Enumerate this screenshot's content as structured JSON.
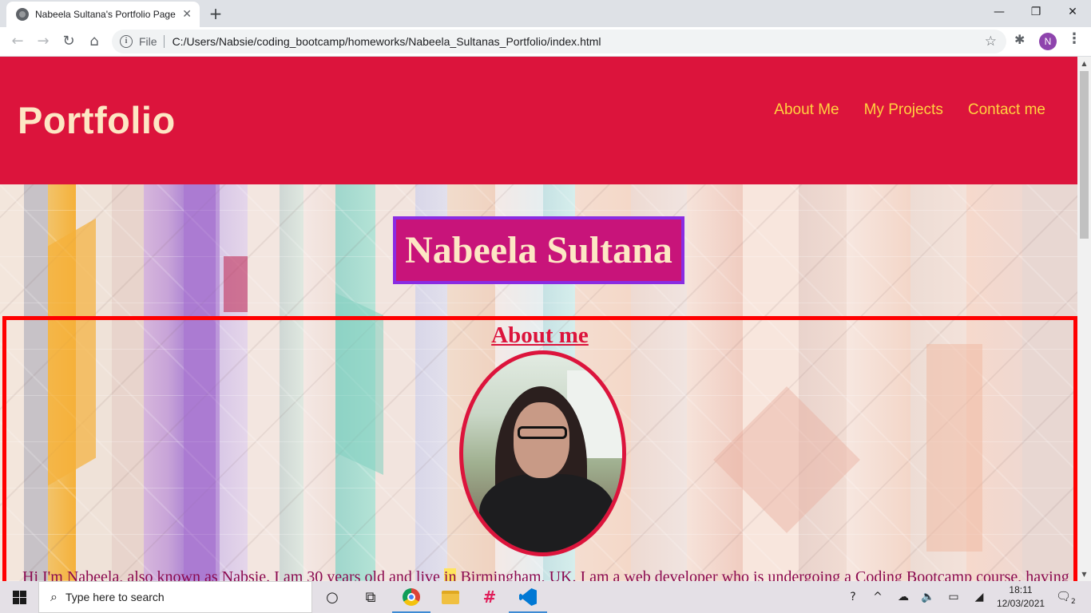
{
  "browser": {
    "tab_title": "Nabeela Sultana's Portfolio Page",
    "tab_close": "✕",
    "new_tab": "+",
    "win_minimize": "—",
    "win_restore": "❐",
    "win_close": "✕",
    "back": "←",
    "forward": "→",
    "reload": "↻",
    "home": "⌂",
    "site_info": "i",
    "file_label": "File",
    "url": "C:/Users/Nabsie/coding_bootcamp/homeworks/Nabeela_Sultanas_Portfolio/index.html",
    "bookmark": "☆",
    "extensions": "✱",
    "profile_initial": "N",
    "menu": "⋮"
  },
  "page": {
    "logo": "Portfolio",
    "nav": [
      "About Me",
      "My Projects",
      "Contact me"
    ],
    "name": "Nabeela Sultana",
    "about_heading": "About me",
    "about_text_before": "Hi I'm Nabeela, also known as Nabsie. I am 30 years old and live ",
    "about_text_highlight": "in",
    "about_text_after": " Birmingham, UK. I am a web developer who is undergoing a Coding Bootcamp course, having",
    "colors": {
      "header_bg": "#dc143c",
      "logo": "#fde7c4",
      "nav_link": "#ffd23f",
      "name_box_bg": "#c8147a",
      "name_box_border": "#8a2be2",
      "about_border": "#ff0000",
      "about_heading": "#dc143c",
      "about_text": "#8b0a50"
    }
  },
  "scrollbar": {
    "up": "▲",
    "down": "▼"
  },
  "taskbar": {
    "search_icon": "⌕",
    "search_placeholder": "Type here to search",
    "cortana": "○",
    "task_view": "⧉",
    "slack": "#",
    "help": "?",
    "chevron": "^",
    "cloud": "☁",
    "volume": "🔈",
    "battery": "▭",
    "wifi": "◢",
    "time": "18:11",
    "date": "12/03/2021",
    "notifications": "🗨",
    "notification_count": "2"
  }
}
